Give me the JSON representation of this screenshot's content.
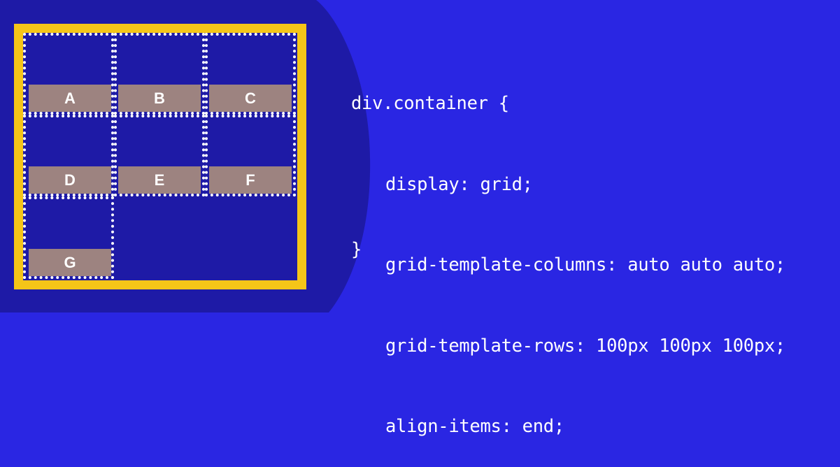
{
  "colors": {
    "background": "#2a26e3",
    "background_shape": "#1e1aa6",
    "frame_border": "#f5c518",
    "item_fill": "#9d8380",
    "cell_border": "#ffffff"
  },
  "grid_items": [
    "A",
    "B",
    "C",
    "D",
    "E",
    "F",
    "G"
  ],
  "code": {
    "selector_line": "div.container {",
    "lines": [
      "display: grid;",
      "grid-template-columns: auto auto auto;",
      "grid-template-rows: 100px 100px 100px;",
      "align-items: end;"
    ],
    "closing": "}"
  }
}
